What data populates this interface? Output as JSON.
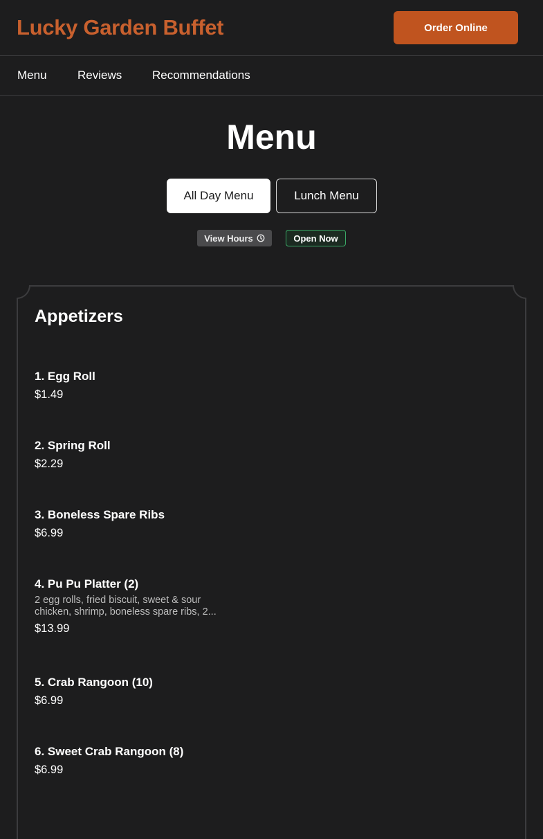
{
  "brand": {
    "name": "Lucky Garden Buffet",
    "color": "#c8602e"
  },
  "header": {
    "order_label": "Order Online",
    "accent": "#c0541f"
  },
  "nav": {
    "items": [
      {
        "label": "Menu"
      },
      {
        "label": "Reviews"
      },
      {
        "label": "Recommendations"
      }
    ]
  },
  "page": {
    "title": "Menu"
  },
  "menu_tabs": {
    "active": "All Day Menu",
    "inactive": "Lunch Menu"
  },
  "status": {
    "hours_label": "View Hours",
    "hours_icon": "clock-icon",
    "open_label": "Open Now",
    "open_color": "#3aa866"
  },
  "section": {
    "title": "Appetizers",
    "items": [
      {
        "name": "1. Egg Roll",
        "description": "",
        "price": "$1.49"
      },
      {
        "name": "2. Spring Roll",
        "description": "",
        "price": "$2.29"
      },
      {
        "name": "3. Boneless Spare Ribs",
        "description": "",
        "price": "$6.99"
      },
      {
        "name": "4. Pu Pu Platter (2)",
        "description": "2 egg rolls, fried biscuit, sweet & sour chicken, shrimp, boneless spare ribs, 2...",
        "price": "$13.99"
      },
      {
        "name": "5. Crab Rangoon (10)",
        "description": "",
        "price": "$6.99"
      },
      {
        "name": "6. Sweet Crab Rangoon (8)",
        "description": "",
        "price": "$6.99"
      }
    ]
  }
}
